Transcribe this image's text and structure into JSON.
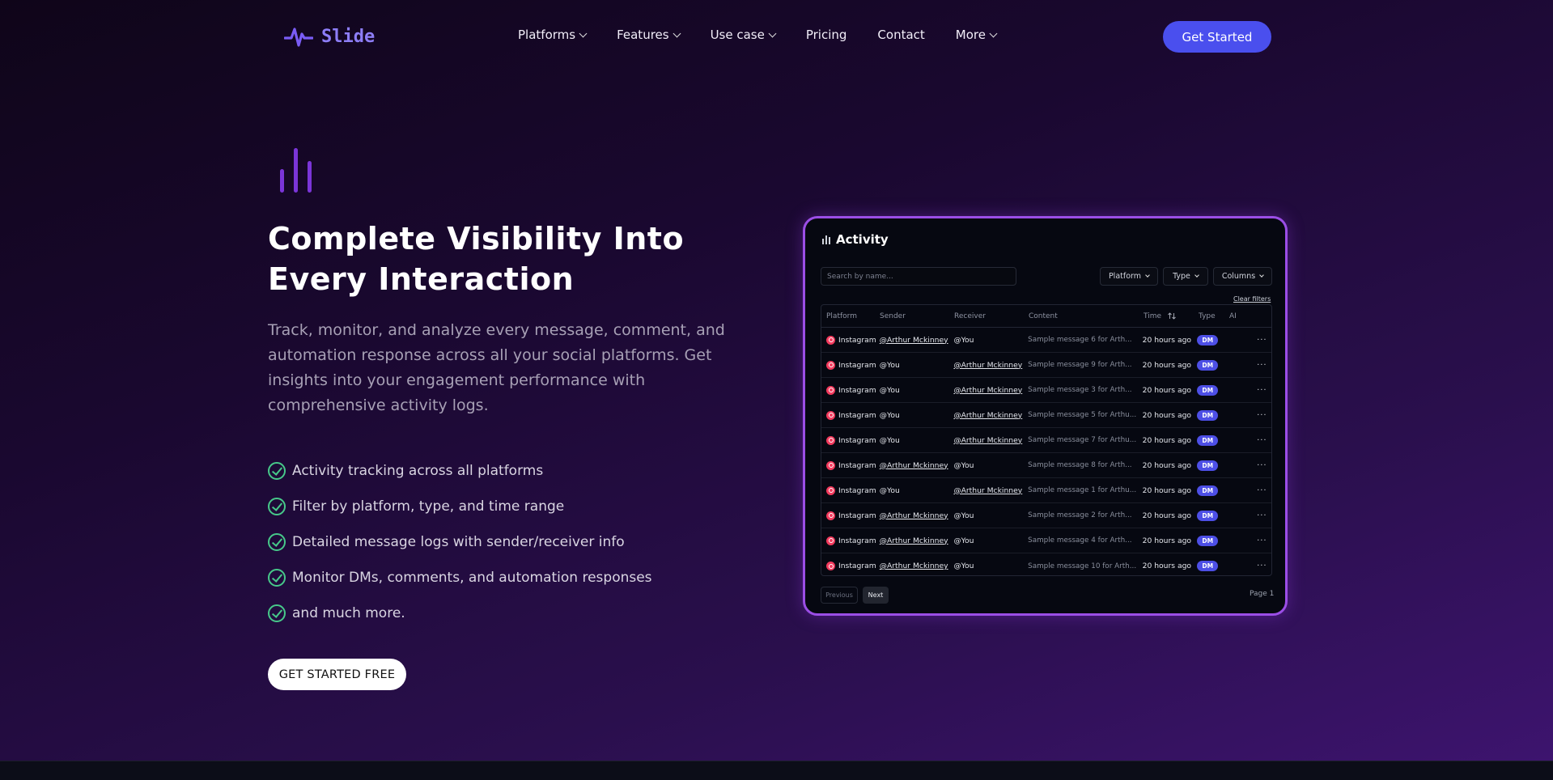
{
  "nav": {
    "logo_text": "Slide",
    "links": [
      {
        "label": "Platforms",
        "dropdown": true
      },
      {
        "label": "Features",
        "dropdown": true
      },
      {
        "label": "Use case",
        "dropdown": true
      },
      {
        "label": "Pricing",
        "dropdown": false
      },
      {
        "label": "Contact",
        "dropdown": false
      },
      {
        "label": "More",
        "dropdown": true
      }
    ],
    "cta": "Get Started"
  },
  "hero": {
    "title": "Complete Visibility Into Every Interaction",
    "description": "Track, monitor, and analyze every message, comment, and automation response across all your social platforms. Get insights into your engagement performance with comprehensive activity logs.",
    "features": [
      "Activity tracking across all platforms",
      "Filter by platform, type, and time range",
      "Detailed message logs with sender/receiver info",
      "Monitor DMs, comments, and automation responses",
      "and much more."
    ],
    "cta": "GET STARTED FREE"
  },
  "card": {
    "title": "Activity",
    "search_placeholder": "Search by name...",
    "filters": [
      "Platform",
      "Type",
      "Columns"
    ],
    "clear_filters": "Clear filters",
    "columns": [
      "Platform",
      "Sender",
      "Receiver",
      "Content",
      "Time",
      "Type",
      "AI"
    ],
    "rows": [
      {
        "platform": "Instagram",
        "sender": "@Arthur Mckinney",
        "receiver": "@You",
        "content": "Sample message 6 for Arth...",
        "time": "20 hours ago",
        "type": "DM"
      },
      {
        "platform": "Instagram",
        "sender": "@You",
        "receiver": "@Arthur Mckinney",
        "content": "Sample message 9 for Arth...",
        "time": "20 hours ago",
        "type": "DM"
      },
      {
        "platform": "Instagram",
        "sender": "@You",
        "receiver": "@Arthur Mckinney",
        "content": "Sample message 3 for Arth...",
        "time": "20 hours ago",
        "type": "DM"
      },
      {
        "platform": "Instagram",
        "sender": "@You",
        "receiver": "@Arthur Mckinney",
        "content": "Sample message 5 for Arthu...",
        "time": "20 hours ago",
        "type": "DM"
      },
      {
        "platform": "Instagram",
        "sender": "@You",
        "receiver": "@Arthur Mckinney",
        "content": "Sample message 7 for Arthu...",
        "time": "20 hours ago",
        "type": "DM"
      },
      {
        "platform": "Instagram",
        "sender": "@Arthur Mckinney",
        "receiver": "@You",
        "content": "Sample message 8 for Arth...",
        "time": "20 hours ago",
        "type": "DM"
      },
      {
        "platform": "Instagram",
        "sender": "@You",
        "receiver": "@Arthur Mckinney",
        "content": "Sample message 1 for Arthu...",
        "time": "20 hours ago",
        "type": "DM"
      },
      {
        "platform": "Instagram",
        "sender": "@Arthur Mckinney",
        "receiver": "@You",
        "content": "Sample message 2 for Arth...",
        "time": "20 hours ago",
        "type": "DM"
      },
      {
        "platform": "Instagram",
        "sender": "@Arthur Mckinney",
        "receiver": "@You",
        "content": "Sample message 4 for Arth...",
        "time": "20 hours ago",
        "type": "DM"
      },
      {
        "platform": "Instagram",
        "sender": "@Arthur Mckinney",
        "receiver": "@You",
        "content": "Sample message 10 for Arth...",
        "time": "20 hours ago",
        "type": "DM"
      }
    ],
    "previous": "Previous",
    "next": "Next",
    "page_label": "Page 1"
  },
  "colors": {
    "accent": "#4a4fee",
    "logo": "#8d7df6",
    "card_border": "#9b4ee6",
    "check": "#47c98a",
    "instagram": "#f23a5d"
  },
  "icons": {
    "logo": "pulse-wave-icon",
    "hero": "bar-chart-icon",
    "card_title": "bar-chart-icon",
    "row_platform": "instagram-icon",
    "row_actions": "more-dots-icon",
    "feature": "check-circle-icon",
    "sort": "sort-arrows-icon"
  }
}
